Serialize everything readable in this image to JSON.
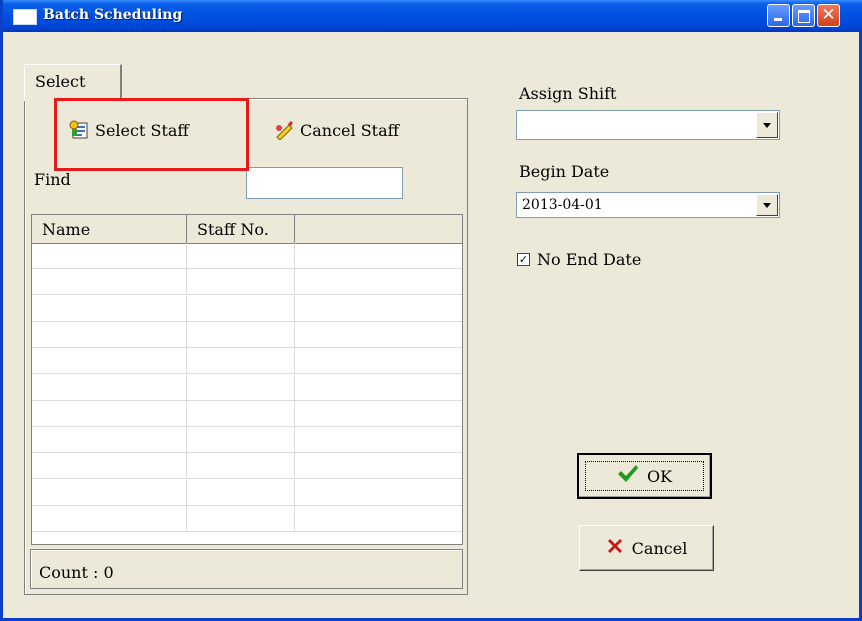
{
  "window": {
    "title": "Batch Scheduling"
  },
  "tabs": [
    {
      "label": "Select"
    }
  ],
  "left_panel": {
    "select_staff_label": "Select Staff",
    "cancel_staff_label": "Cancel Staff",
    "find_label": "Find",
    "find_value": "",
    "columns": [
      "Name",
      "Staff No.",
      ""
    ],
    "rows": [],
    "count_text": "Count : 0"
  },
  "right_panel": {
    "assign_shift_label": "Assign Shift",
    "assign_shift_value": "",
    "begin_date_label": "Begin Date",
    "begin_date_value": "2013-04-01",
    "no_end_date_label": "No End Date",
    "no_end_date_checked": true
  },
  "buttons": {
    "ok_label": "OK",
    "cancel_label": "Cancel"
  },
  "colors": {
    "title_bar": "#0050E0",
    "highlight": "#E61A1A",
    "window_bg": "#ECE9D8"
  }
}
